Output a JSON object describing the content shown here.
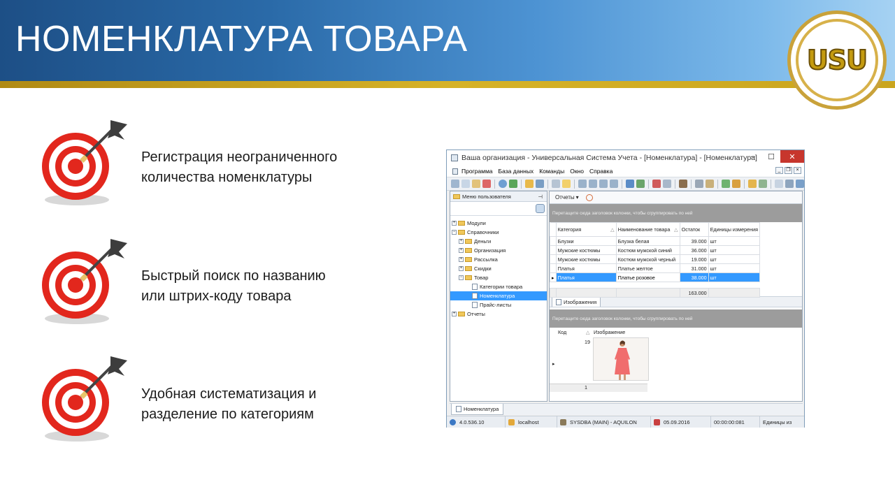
{
  "slide": {
    "title": "НОМЕНКЛАТУРА ТОВАРА",
    "logo_text": "USU",
    "bullets": [
      {
        "line1": "Регистрация неограниченного",
        "line2": "количества номенклатуры"
      },
      {
        "line1": "Быстрый поиск по названию",
        "line2": "или штрих-коду товара"
      },
      {
        "line1": "Удобная систематизация и",
        "line2": "разделение по категориям"
      }
    ]
  },
  "app": {
    "window_title": "Ваша организация - Универсальная Система Учета - [Номенклатура] - [Номенклатура]",
    "window_buttons": {
      "minimize": "–",
      "maximize": "☐",
      "close": "✕"
    },
    "menu": [
      "Программа",
      "База данных",
      "Команды",
      "Окно",
      "Справка"
    ],
    "left_panel": {
      "header": "Меню пользователя",
      "pin": "⊣",
      "tree": [
        {
          "label": "Модули",
          "level": 0,
          "type": "folder",
          "toggle": "+"
        },
        {
          "label": "Справочники",
          "level": 0,
          "type": "folder",
          "toggle": "−"
        },
        {
          "label": "Деньги",
          "level": 1,
          "type": "folder",
          "toggle": "+"
        },
        {
          "label": "Организация",
          "level": 1,
          "type": "folder",
          "toggle": "+"
        },
        {
          "label": "Рассылка",
          "level": 1,
          "type": "folder",
          "toggle": "+"
        },
        {
          "label": "Скидки",
          "level": 1,
          "type": "folder",
          "toggle": "+"
        },
        {
          "label": "Товар",
          "level": 1,
          "type": "folder",
          "toggle": "−"
        },
        {
          "label": "Категории товара",
          "level": 2,
          "type": "doc"
        },
        {
          "label": "Номенклатура",
          "level": 2,
          "type": "doc",
          "selected": true
        },
        {
          "label": "Прайс-листы",
          "level": 2,
          "type": "doc"
        },
        {
          "label": "Отчеты",
          "level": 0,
          "type": "folder",
          "toggle": "+"
        }
      ]
    },
    "reports_button": "Отчеты",
    "group_hint": "Перетащите сюда заголовок колонки, чтобы сгруппировать по ней",
    "grid": {
      "columns": [
        "Категория",
        "Наименование товара",
        "Остаток",
        "Единицы измерения"
      ],
      "rows": [
        [
          "Блузки",
          "Блузка белая",
          "39.000",
          "шт"
        ],
        [
          "Мужские костюмы",
          "Костюм мужской синий",
          "36.000",
          "шт"
        ],
        [
          "Мужские костюмы",
          "Костюм мужской черный",
          "19.000",
          "шт"
        ],
        [
          "Платья",
          "Платье желтое",
          "31.000",
          "шт"
        ],
        [
          "Платья",
          "Платье розовое",
          "38.000",
          "шт"
        ]
      ],
      "selected_row": 4,
      "total": "163.000"
    },
    "images_tab": "Изображения",
    "images_grid": {
      "group_hint": "Перетащите сюда заголовок колонки, чтобы сгруппировать по ней",
      "columns": [
        "Код",
        "Изображение"
      ],
      "code": "19",
      "count": "1"
    },
    "bottom_tab": "Номенклатура",
    "status": {
      "version": "4.0.536.10",
      "server": "localhost",
      "user": "SYSDBA (MAIN) - AQUILON",
      "date": "05.09.2016",
      "timer": "00:00:00:081",
      "units": "Единицы из"
    },
    "colors": {
      "selection": "#3399ff",
      "group_bar": "#9c9c9c",
      "close_button": "#c7362d"
    }
  }
}
